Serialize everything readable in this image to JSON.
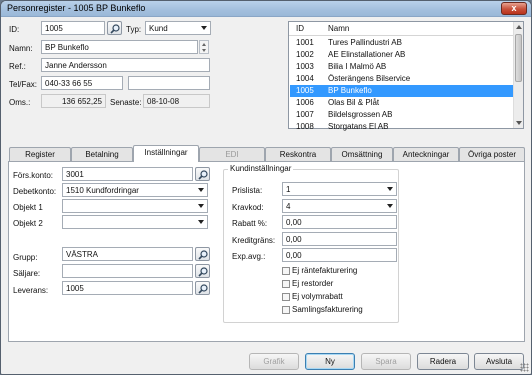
{
  "window": {
    "title": "Personregister - 1005 BP Bunkeflo",
    "close_glyph": "x"
  },
  "header": {
    "id_label": "ID:",
    "id_value": "1005",
    "typ_label": "Typ:",
    "typ_value": "Kund",
    "namn_label": "Namn:",
    "namn_value": "BP Bunkeflo",
    "ref_label": "Ref.:",
    "ref_value": "Janne Andersson",
    "tel_label": "Tel/Fax:",
    "tel_value": "040-33 66 55",
    "fax_value": "",
    "oms_label": "Oms.:",
    "oms_value": "136 652,25",
    "senaste_label": "Senaste:",
    "senaste_value": "08-10-08"
  },
  "list": {
    "headers": [
      "ID",
      "Namn"
    ],
    "rows": [
      [
        "1001",
        "Tures Pallindustri AB"
      ],
      [
        "1002",
        "AE Elinstallationer AB"
      ],
      [
        "1003",
        "Bilia I Malmö AB"
      ],
      [
        "1004",
        "Österängens Bilservice"
      ],
      [
        "1005",
        "BP Bunkeflo"
      ],
      [
        "1006",
        "Olas Bil & Plåt"
      ],
      [
        "1007",
        "Bildelsgrossen AB"
      ],
      [
        "1008",
        "Storgatans El AB"
      ]
    ],
    "selected_index": 4
  },
  "tabs": [
    {
      "label": "Register"
    },
    {
      "label": "Betalning"
    },
    {
      "label": "Inställningar"
    },
    {
      "label": "EDI"
    },
    {
      "label": "Reskontra"
    },
    {
      "label": "Omsättning"
    },
    {
      "label": "Anteckningar"
    },
    {
      "label": "Övriga poster"
    }
  ],
  "settings": {
    "fors_label": "Förs.konto:",
    "fors_value": "3001",
    "debet_label": "Debetkonto:",
    "debet_value": "1510  Kundfordringar",
    "obj1_label": "Objekt 1",
    "obj1_value": "",
    "obj2_label": "Objekt 2",
    "obj2_value": "",
    "grupp_label": "Grupp:",
    "grupp_value": "VÄSTRA",
    "saljare_label": "Säljare:",
    "saljare_value": "",
    "leverans_label": "Leverans:",
    "leverans_value": "1005"
  },
  "kund": {
    "title": "Kundinställningar",
    "prislista_label": "Prislista:",
    "prislista_value": "1",
    "kravkod_label": "Kravkod:",
    "kravkod_value": "4",
    "rabatt_label": "Rabatt %:",
    "rabatt_value": "0,00",
    "kredit_label": "Kreditgräns:",
    "kredit_value": "0,00",
    "exp_label": "Exp.avg.:",
    "exp_value": "0,00",
    "checks": [
      "Ej räntefakturering",
      "Ej restorder",
      "Ej volymrabatt",
      "Samlingsfakturering"
    ]
  },
  "buttons": {
    "grafik": "Grafik",
    "ny": "Ny",
    "spara": "Spara",
    "radera": "Radera",
    "avsluta": "Avsluta"
  },
  "colors": {
    "selection": "#3399ff",
    "titlebar": "#a3bfdd"
  }
}
